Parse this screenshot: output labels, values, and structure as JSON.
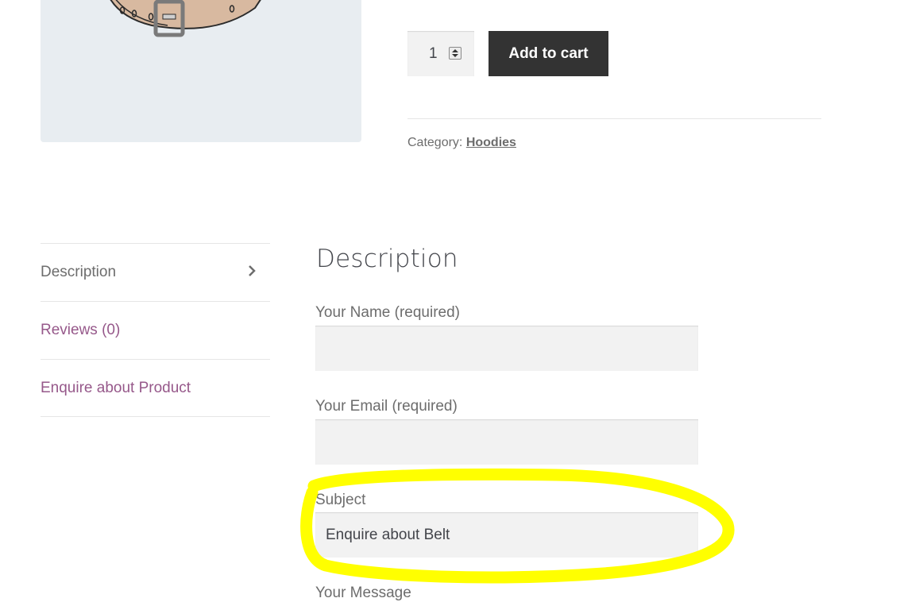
{
  "product": {
    "image_alt": "Belt product image",
    "quantity": "1",
    "add_to_cart_label": "Add to cart",
    "category_label": "Category:",
    "category_link": "Hoodies"
  },
  "tabs": [
    {
      "label": "Description",
      "active": true
    },
    {
      "label": "Reviews (0)",
      "active": false
    },
    {
      "label": "Enquire about Product",
      "active": false
    }
  ],
  "panel": {
    "title": "Description",
    "form": {
      "name_label": "Your Name (required)",
      "name_value": "",
      "email_label": "Your Email (required)",
      "email_value": "",
      "subject_label": "Subject",
      "subject_value": "Enquire about Belt",
      "message_label": "Your Message"
    }
  },
  "colors": {
    "accent_link": "#96588a",
    "button_bg": "#333333",
    "field_bg": "#f2f2f2",
    "highlight": "#ffff00"
  },
  "icons": {
    "tab_chevron": "chevron-right-icon",
    "stepper": "spinner-arrows-icon"
  }
}
